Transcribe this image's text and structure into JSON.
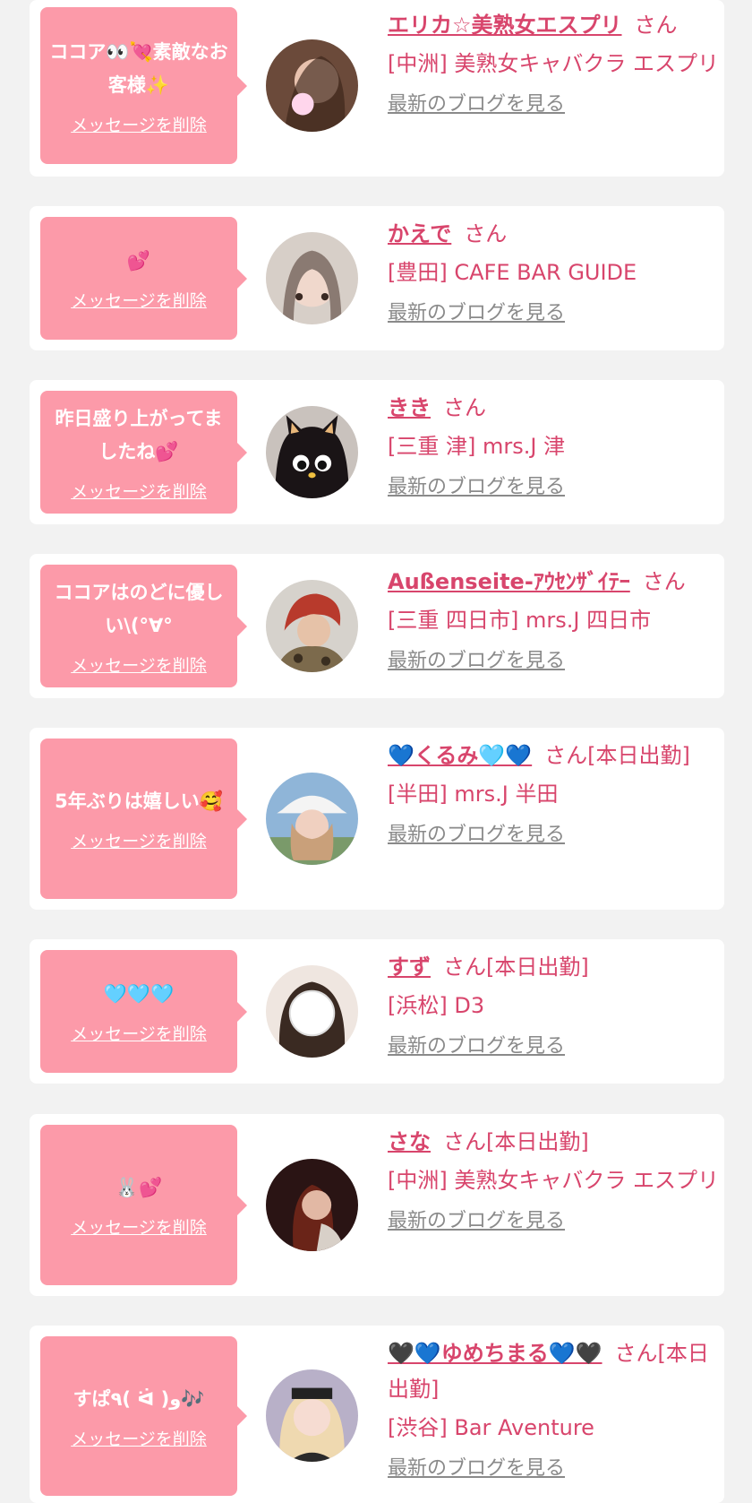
{
  "colors": {
    "accent": "#d8456c",
    "bubble": "#fc9aa9",
    "background": "#f2f2f2",
    "link_gray": "#8a8a8a"
  },
  "labels": {
    "delete_message": "メッセージを削除",
    "view_blog": "最新のブログを見る",
    "san": "さん"
  },
  "cards": [
    {
      "message": "ココア👀💘素敵なお客様✨",
      "name": "エリカ☆美熟女エスプリ",
      "suffix": "さん",
      "shop": "[中洲] 美熟女キャバクラ エスプリ"
    },
    {
      "message": "💕",
      "name": "かえで",
      "suffix": "さん",
      "shop": "[豊田] CAFE BAR GUIDE"
    },
    {
      "message": "昨日盛り上がってましたね💕",
      "name": "きき",
      "suffix": "さん",
      "shop": "[三重 津] mrs.J 津"
    },
    {
      "message": "ココアはのどに優しい\\(°∀°",
      "name": "Außenseite-ｱｳｾﾝｻﾞｲﾃｰ",
      "suffix": "さん",
      "shop": "[三重 四日市] mrs.J 四日市"
    },
    {
      "message": "5年ぶりは嬉しい🥰",
      "name": "💙くるみ🩵💙",
      "suffix": "さん[本日出勤]",
      "shop": "[半田] mrs.J 半田"
    },
    {
      "message": "🩵🩵🩵",
      "name": "すず",
      "suffix": "さん[本日出勤]",
      "shop": "[浜松] D3"
    },
    {
      "message": "🐰💕",
      "name": "さな",
      "suffix": "さん[本日出勤]",
      "shop": "[中洲] 美熟女キャバクラ エスプリ"
    },
    {
      "message": "すぱ٩( ᐛ )و🎶",
      "name": "🖤💙ゆめちまる💙🖤",
      "suffix": "さん[本日出勤]",
      "shop": "[渋谷] Bar Aventure"
    }
  ]
}
